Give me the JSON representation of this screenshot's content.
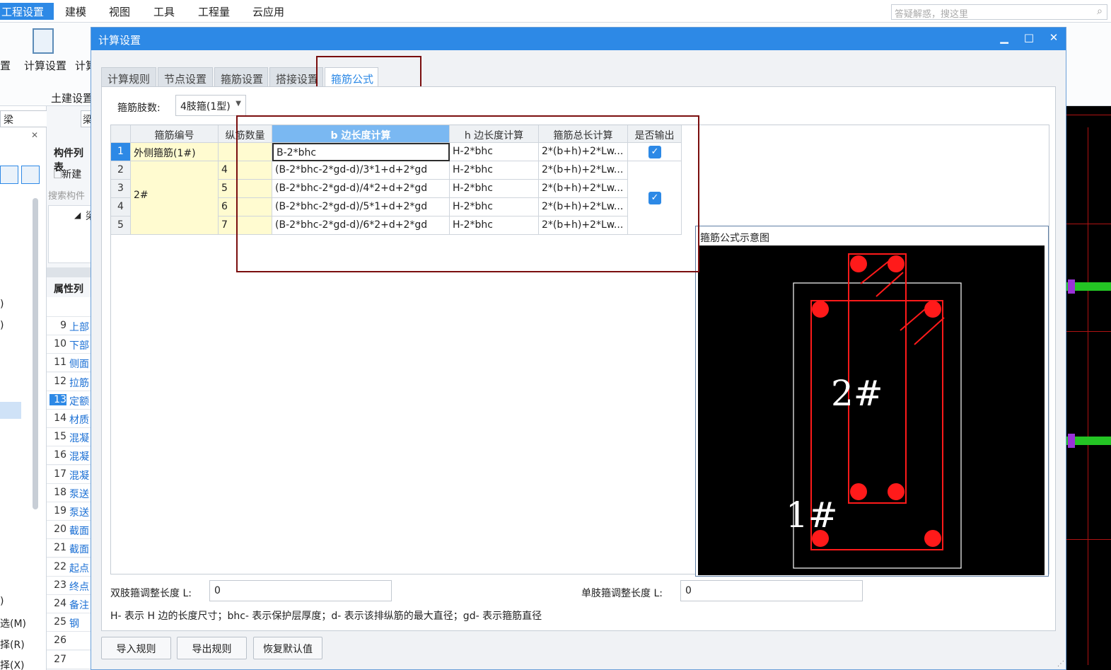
{
  "menubar": {
    "items": [
      "工程设置",
      "建模",
      "视图",
      "工具",
      "工程量",
      "云应用"
    ],
    "search_placeholder": "答疑解惑，搜这里"
  },
  "ribbon": {
    "calc_settings_label": "计算设置",
    "calc_rules_label": "计算",
    "group_label": "土建设置",
    "left_cut_label": "置"
  },
  "left_panel": {
    "dropdown_value": "梁",
    "dropdown_value2": "梁",
    "component_list_title": "构件列表",
    "new_label": "新建",
    "search_placeholder": "搜索构件",
    "tree_node": "梁",
    "property_list_title": "属性列表",
    "side_labels": [
      ")",
      ")",
      ")",
      "选(M)",
      "择(R)",
      "择(X)"
    ],
    "properties": [
      {
        "num": "9",
        "name": "上部"
      },
      {
        "num": "10",
        "name": "下部"
      },
      {
        "num": "11",
        "name": "侧面"
      },
      {
        "num": "12",
        "name": "拉筋"
      },
      {
        "num": "13",
        "name": "定额"
      },
      {
        "num": "14",
        "name": "材质"
      },
      {
        "num": "15",
        "name": "混凝"
      },
      {
        "num": "16",
        "name": "混凝"
      },
      {
        "num": "17",
        "name": "混凝"
      },
      {
        "num": "18",
        "name": "泵送"
      },
      {
        "num": "19",
        "name": "泵送"
      },
      {
        "num": "20",
        "name": "截面"
      },
      {
        "num": "21",
        "name": "截面"
      },
      {
        "num": "22",
        "name": "起点"
      },
      {
        "num": "23",
        "name": "终点"
      },
      {
        "num": "24",
        "name": "备注"
      },
      {
        "num": "25",
        "name": "钢"
      },
      {
        "num": "26",
        "name": ""
      },
      {
        "num": "27",
        "name": ""
      }
    ]
  },
  "dialog": {
    "title": "计算设置",
    "tabs": [
      "计算规则",
      "节点设置",
      "箍筋设置",
      "搭接设置",
      "箍筋公式"
    ],
    "active_tab": "箍筋公式",
    "stirrup_legs_label": "箍筋肢数:",
    "stirrup_legs_value": "4肢箍(1型)",
    "table": {
      "headers": [
        "箍筋编号",
        "纵筋数量",
        "b 边长度计算",
        "h 边长度计算",
        "箍筋总长计算",
        "是否输出"
      ],
      "rows": [
        {
          "num": "1",
          "id": "外侧箍筋(1#)",
          "count": "",
          "b": "B-2*bhc",
          "h": "H-2*bhc",
          "total": "2*(b+h)+2*Lw..."
        },
        {
          "num": "2",
          "id": "",
          "count": "4",
          "b": "(B-2*bhc-2*gd-d)/3*1+d+2*gd",
          "h": "H-2*bhc",
          "total": "2*(b+h)+2*Lw..."
        },
        {
          "num": "3",
          "id": "2#",
          "count": "5",
          "b": "(B-2*bhc-2*gd-d)/4*2+d+2*gd",
          "h": "H-2*bhc",
          "total": "2*(b+h)+2*Lw..."
        },
        {
          "num": "4",
          "id": "",
          "count": "6",
          "b": "(B-2*bhc-2*gd-d)/5*1+d+2*gd",
          "h": "H-2*bhc",
          "total": "2*(b+h)+2*Lw..."
        },
        {
          "num": "5",
          "id": "",
          "count": "7",
          "b": "(B-2*bhc-2*gd-d)/6*2+d+2*gd",
          "h": "H-2*bhc",
          "total": "2*(b+h)+2*Lw..."
        }
      ]
    },
    "diagram": {
      "caption": "箍筋公式示意图",
      "label_inner": "2#",
      "label_outer": "1#"
    },
    "double_leg_label": "双肢箍调整长度 L:",
    "double_leg_value": "0",
    "single_leg_label": "单肢箍调整长度 L:",
    "single_leg_value": "0",
    "note": "H- 表示 H 边的长度尺寸；bhc- 表示保护层厚度；d- 表示该排纵筋的最大直径；gd- 表示箍筋直径",
    "buttons": [
      "导入规则",
      "导出规则",
      "恢复默认值"
    ]
  },
  "colors": {
    "accent": "#2d89e6",
    "highlight_box": "#7a0e0e",
    "rebar": "#ff1a1a",
    "yellow_cell": "#fffbd0"
  }
}
